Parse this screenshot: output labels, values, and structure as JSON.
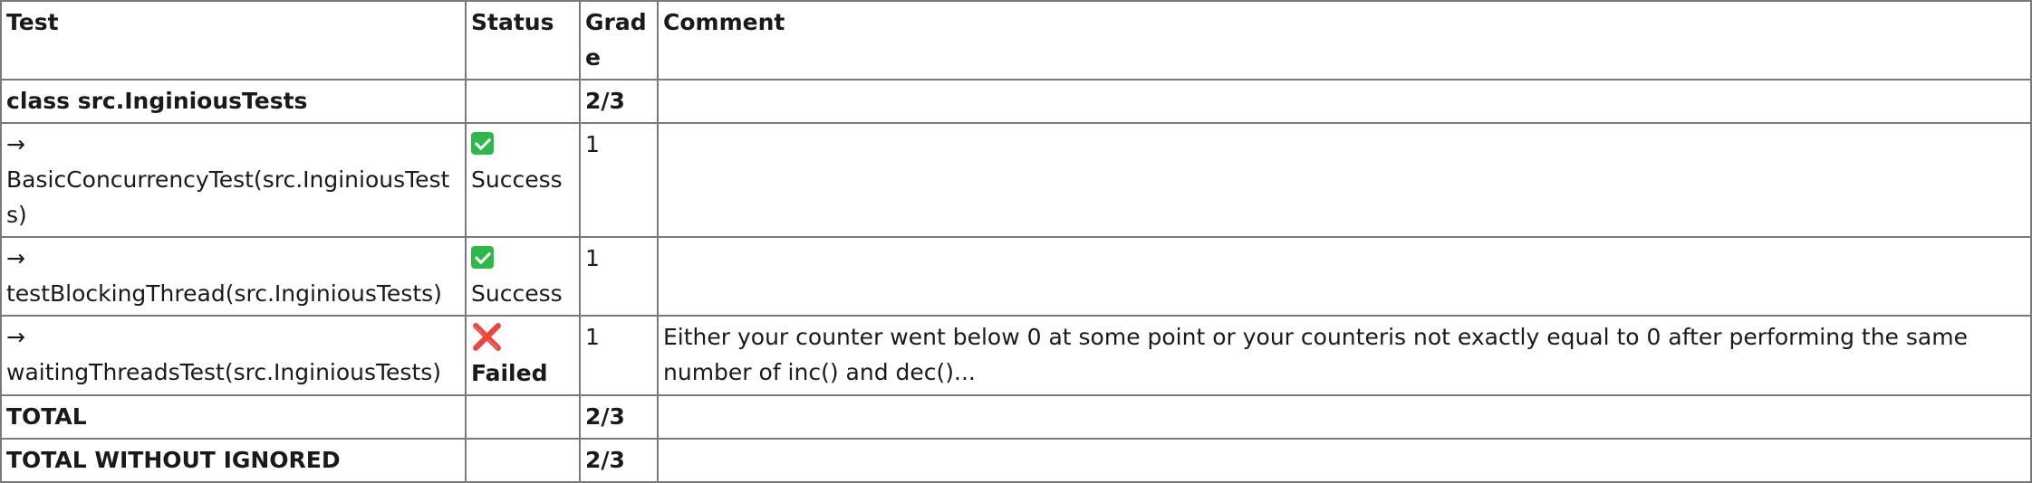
{
  "columns": {
    "test": "Test",
    "status": "Status",
    "grade": "Grade",
    "comment": "Comment"
  },
  "rows": [
    {
      "test": "class src.InginiousTests",
      "status": "",
      "grade": "2/3",
      "comment": ""
    },
    {
      "test": "→ BasicConcurrencyTest(src.InginiousTests)",
      "status": "Success",
      "status_icon": "check-icon",
      "grade": "1",
      "comment": ""
    },
    {
      "test": "→ testBlockingThread(src.InginiousTests)",
      "status": "Success",
      "status_icon": "check-icon",
      "grade": "1",
      "comment": ""
    },
    {
      "test": "→ waitingThreadsTest(src.InginiousTests)",
      "status": "Failed",
      "status_icon": "cross-icon",
      "grade": "1",
      "comment": "Either your counter went below 0 at some point or your counteris not exactly equal to 0 after performing the same number of inc() and dec()..."
    },
    {
      "test": "TOTAL",
      "status": "",
      "grade": "2/3",
      "comment": ""
    },
    {
      "test": "TOTAL WITHOUT IGNORED",
      "status": "",
      "grade": "2/3",
      "comment": ""
    }
  ],
  "icons": {
    "success": "✅",
    "failed": "❌"
  },
  "colors": {
    "success": "#2eb84b",
    "failed": "#e0262b",
    "border": "#7a7a7a"
  }
}
